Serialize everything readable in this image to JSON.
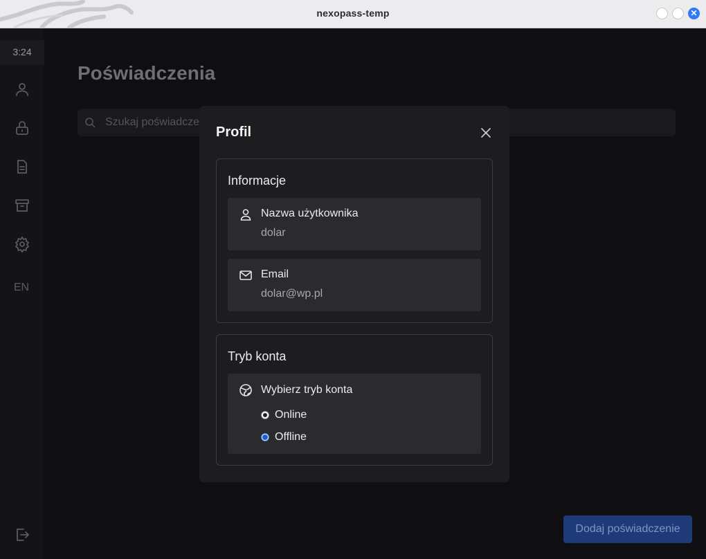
{
  "window": {
    "title": "nexopass-temp"
  },
  "sidebar": {
    "clock": "3:24",
    "icons": [
      "user-icon",
      "lock-icon",
      "document-icon",
      "archive-icon",
      "settings-icon",
      "logout-icon"
    ],
    "language": "EN"
  },
  "main": {
    "title": "Poświadczenia",
    "search_placeholder": "Szukaj poświadczeń...",
    "add_button": "Dodaj poświadczenie"
  },
  "modal": {
    "title": "Profil",
    "info": {
      "title": "Informacje",
      "username_label": "Nazwa użytkownika",
      "username_value": "dolar",
      "email_label": "Email",
      "email_value": "dolar@wp.pl"
    },
    "mode": {
      "title": "Tryb konta",
      "select_label": "Wybierz tryb konta",
      "options": [
        {
          "label": "Online",
          "selected": false
        },
        {
          "label": "Offline",
          "selected": true
        }
      ]
    }
  },
  "colors": {
    "accent": "#1f5fc8",
    "add_button_bg": "#1f3a78"
  }
}
